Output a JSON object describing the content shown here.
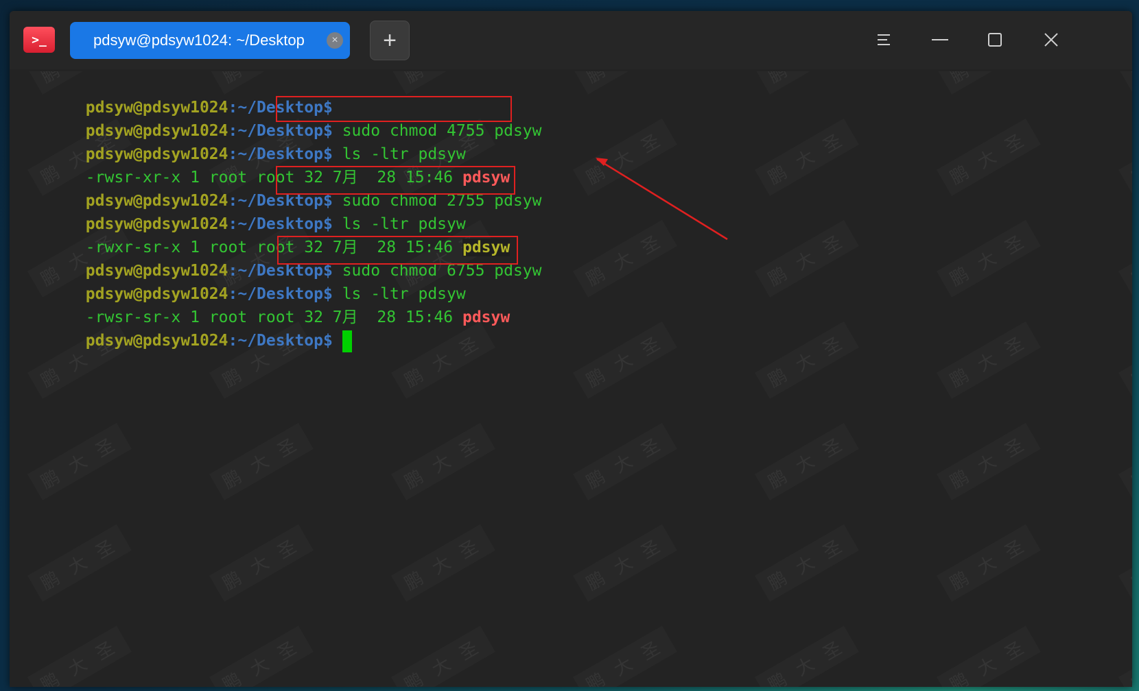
{
  "app": {
    "icon": "terminal-icon",
    "icon_glyph": ">_"
  },
  "tab": {
    "title": "pdsyw@pdsyw1024: ~/Desktop",
    "close_glyph": "×"
  },
  "titlebar": {
    "new_tab_glyph": "+",
    "menu_icon": "hamburger-menu-icon",
    "minimize_icon": "minimize-icon",
    "maximize_icon": "maximize-icon",
    "close_icon": "close-icon"
  },
  "terminal": {
    "prompt_user": "pdsyw@pdsyw1024",
    "prompt_sep": ":",
    "prompt_path": "~/Desktop",
    "prompt_dollar": "$",
    "lines": [
      {
        "cmd": ""
      },
      {
        "cmd": "sudo chmod 4755 pdsyw"
      },
      {
        "cmd": "ls -ltr pdsyw"
      },
      {
        "perm": "-rwsr-xr-x 1 root root 32 7月  28 15:46 ",
        "file": "pdsyw"
      },
      {
        "cmd": "sudo chmod 2755 pdsyw"
      },
      {
        "cmd": "ls -ltr pdsyw"
      },
      {
        "perm": "-rwxr-sr-x 1 root root 32 7月  28 15:46 ",
        "file": "pdsyw"
      },
      {
        "cmd": "sudo chmod 6755 pdsyw"
      },
      {
        "cmd": "ls -ltr pdsyw"
      },
      {
        "perm": "-rwsr-sr-x 1 root root 32 7月  28 15:46 ",
        "file": "pdsyw"
      },
      {
        "cmd": ""
      }
    ]
  },
  "watermark_text": [
    "鹏",
    "大",
    "圣"
  ],
  "colors": {
    "prompt_user": "#a3a321",
    "prompt_path": "#3e78c4",
    "command": "#33c533",
    "setuid_file": "#ff5a5a",
    "setgid_file": "#b6b62a",
    "highlight_box": "#e02020",
    "cursor": "#00d000",
    "tab_active": "#1a78e6"
  }
}
